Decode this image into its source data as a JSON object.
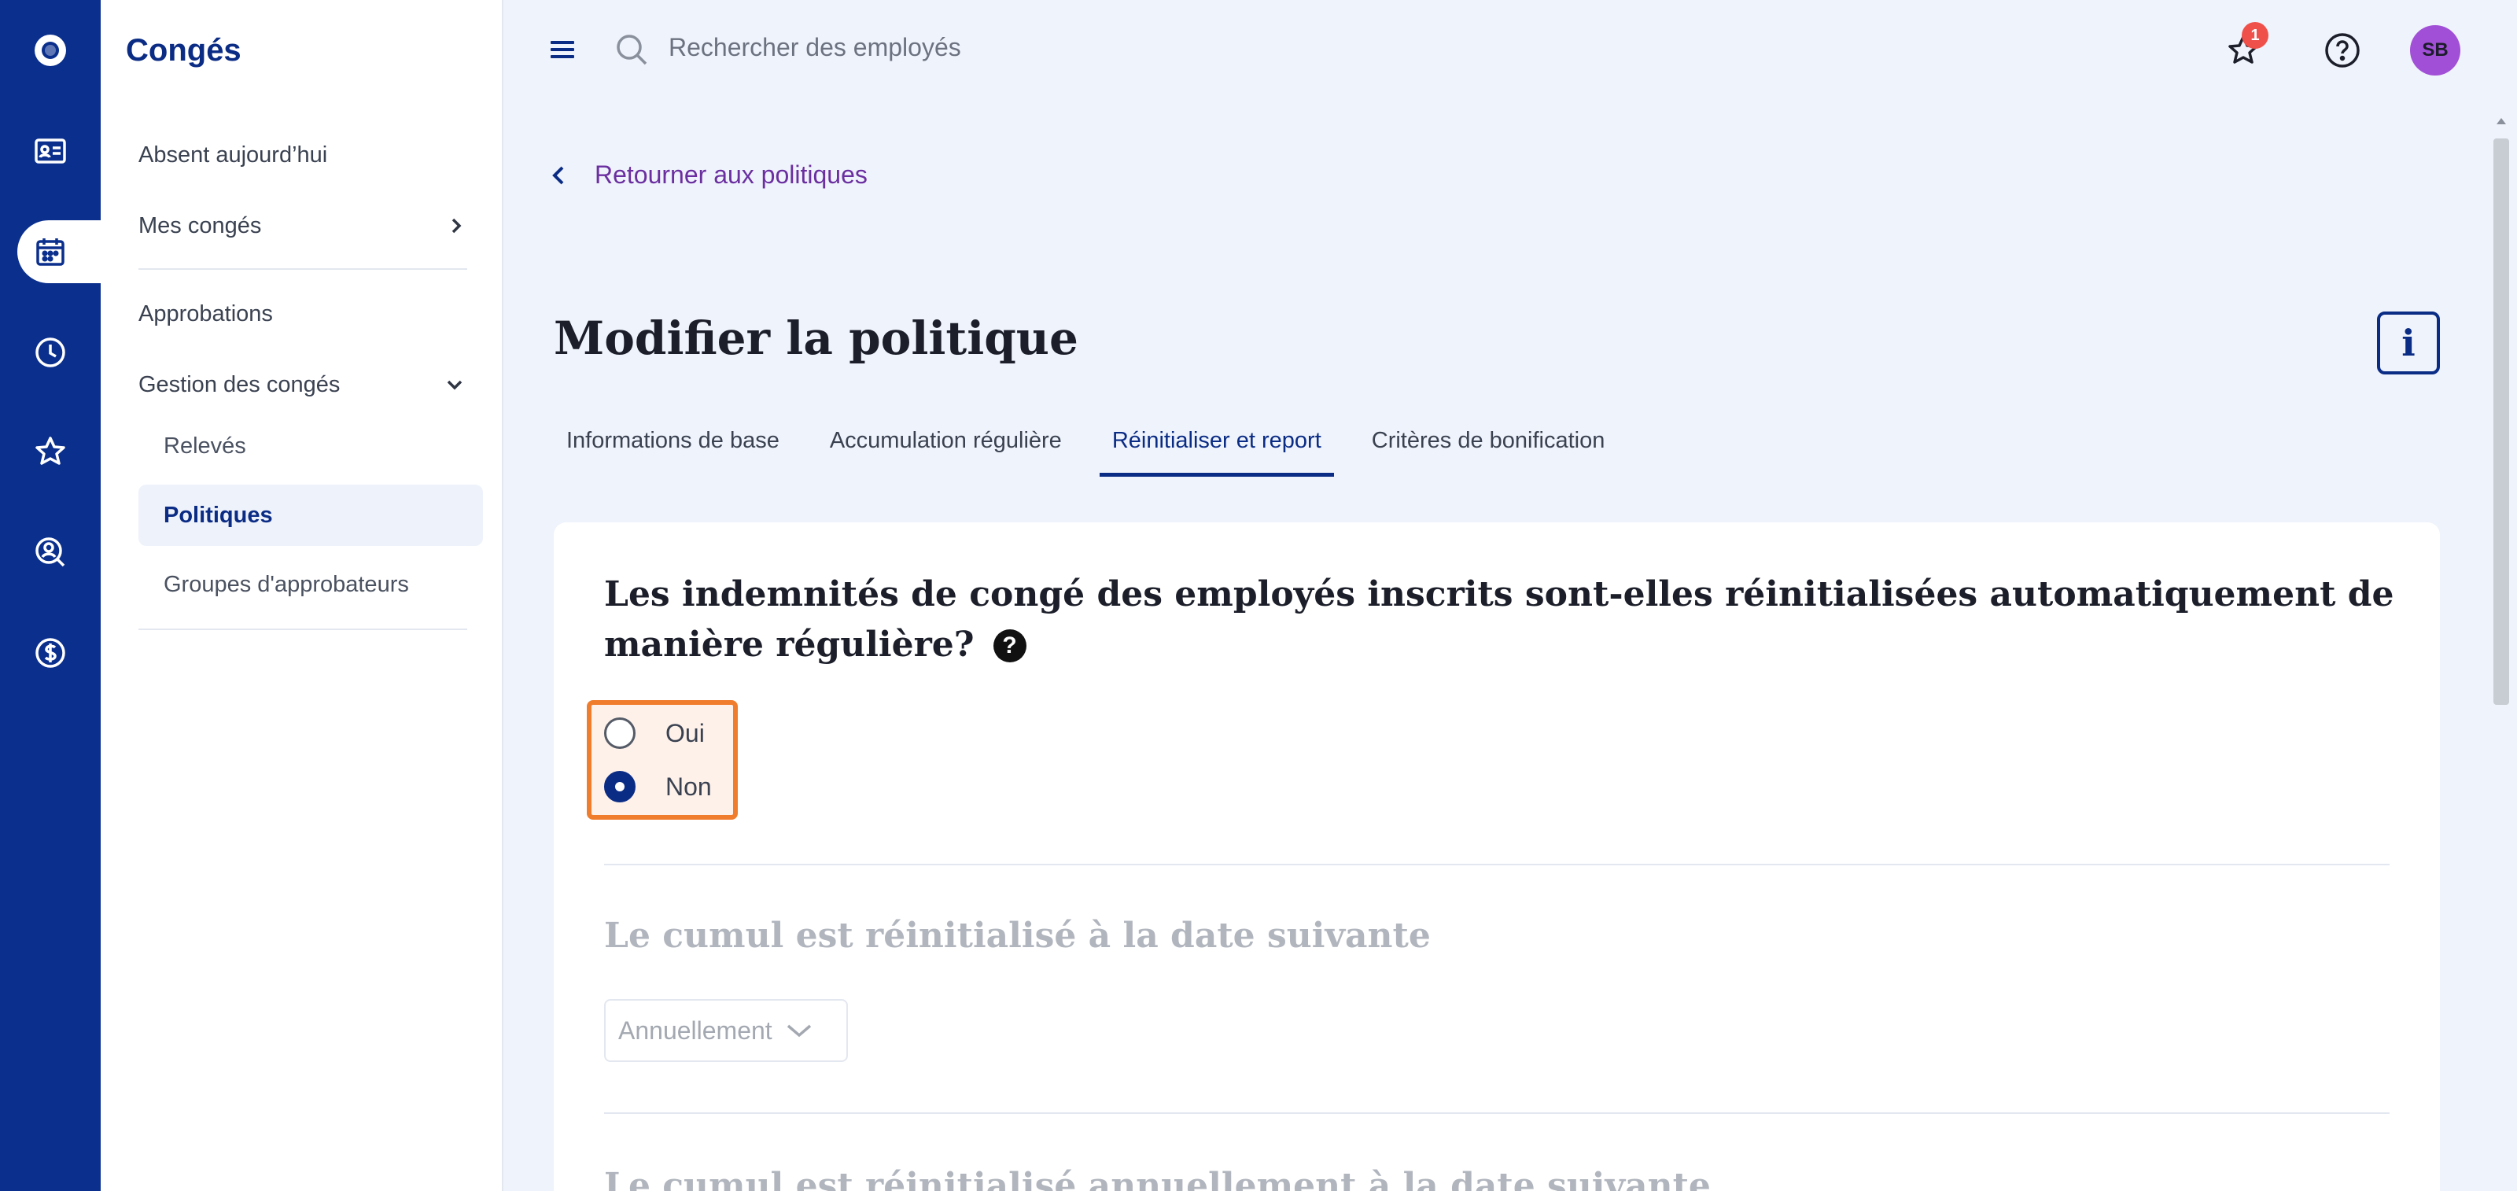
{
  "sidebar": {
    "title": "Congés",
    "items": [
      {
        "label": "Absent aujourd’hui"
      },
      {
        "label": "Mes congés"
      },
      {
        "label": "Approbations"
      },
      {
        "label": "Gestion des congés"
      }
    ],
    "sub_items": [
      {
        "label": "Relevés"
      },
      {
        "label": "Politiques"
      },
      {
        "label": "Groupes d'approbateurs"
      }
    ]
  },
  "topbar": {
    "search_placeholder": "Rechercher des employés",
    "notification_count": "1",
    "avatar_initials": "SB"
  },
  "main": {
    "back_link": "Retourner aux politiques",
    "page_title": "Modifier la politique",
    "info_label": "i",
    "tabs": [
      {
        "label": "Informations de base"
      },
      {
        "label": "Accumulation régulière"
      },
      {
        "label": "Réinitialiser et report"
      },
      {
        "label": "Critères de bonification"
      }
    ],
    "question": "Les indemnités de congé des employés inscrits sont-elles réinitialisées automatiquement de manière régulière?",
    "help_glyph": "?",
    "options": [
      {
        "label": "Oui",
        "checked": false
      },
      {
        "label": "Non",
        "checked": true
      }
    ],
    "section2_title": "Le cumul est réinitialisé à la date suivante",
    "section2_select": "Annuellement",
    "section3_title": "Le cumul est réinitialisé annuellement à la date suivante"
  },
  "colors": {
    "rail": "#0a2f8c",
    "accent": "#0b2c85",
    "link": "#6b2fa0",
    "highlight_border": "#f07d2e",
    "badge": "#f0504a",
    "avatar": "#a14fd6"
  }
}
